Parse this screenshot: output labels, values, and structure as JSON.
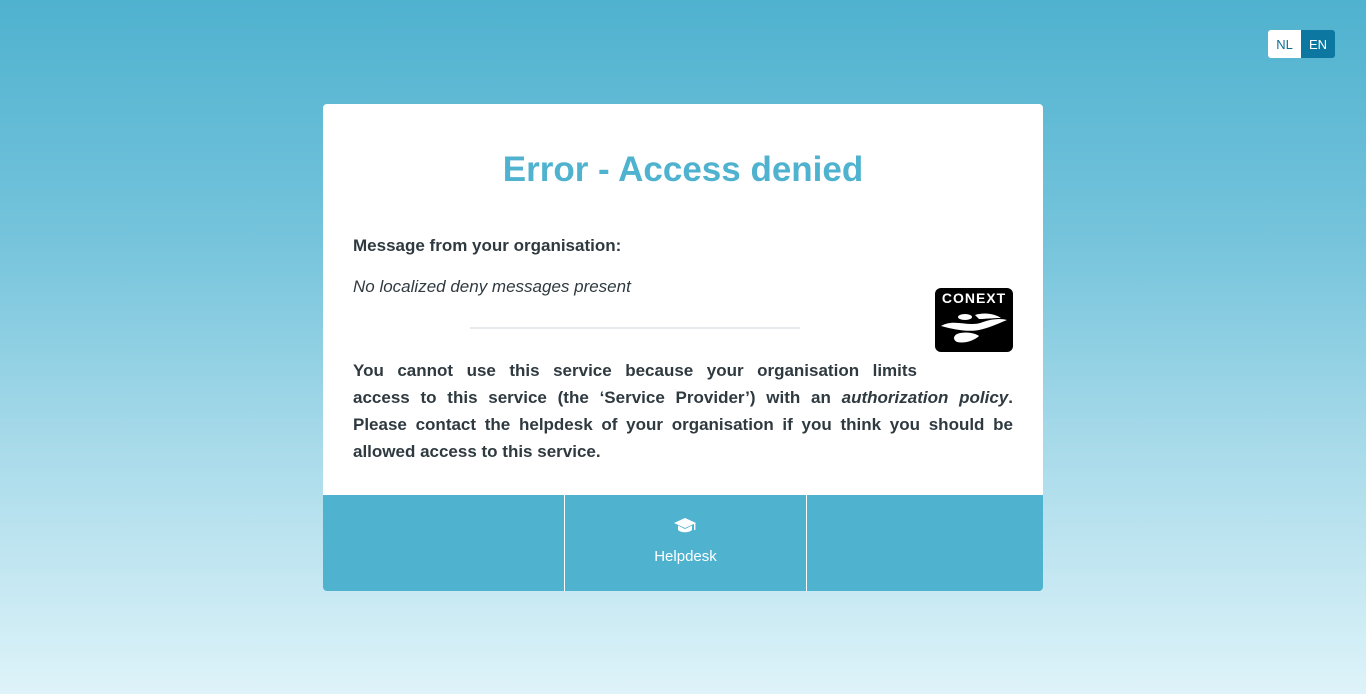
{
  "language_switch": {
    "options": [
      {
        "label": "NL",
        "active": false
      },
      {
        "label": "EN",
        "active": true
      }
    ]
  },
  "card": {
    "title": "Error - Access denied",
    "message_label": "Message from your organisation:",
    "message_text": "No localized deny messages present",
    "logo_text": "CONEXT",
    "body": {
      "line1": "You cannot use this service because your organisation limits",
      "line2_prefix": "access to this service (the ‘Service Provider’) with an ",
      "line2_emphasis": "authorization policy",
      "line2_suffix": ".",
      "line3": "Please contact the helpdesk of your organisation if you think you should be",
      "line4": "allowed access to this service."
    }
  },
  "footer": {
    "helpdesk_label": "Helpdesk",
    "helpdesk_icon": "graduation-cap-icon"
  },
  "colors": {
    "accent": "#4fb2cf",
    "active_language": "#0c77a1",
    "text": "#2f3a40"
  }
}
